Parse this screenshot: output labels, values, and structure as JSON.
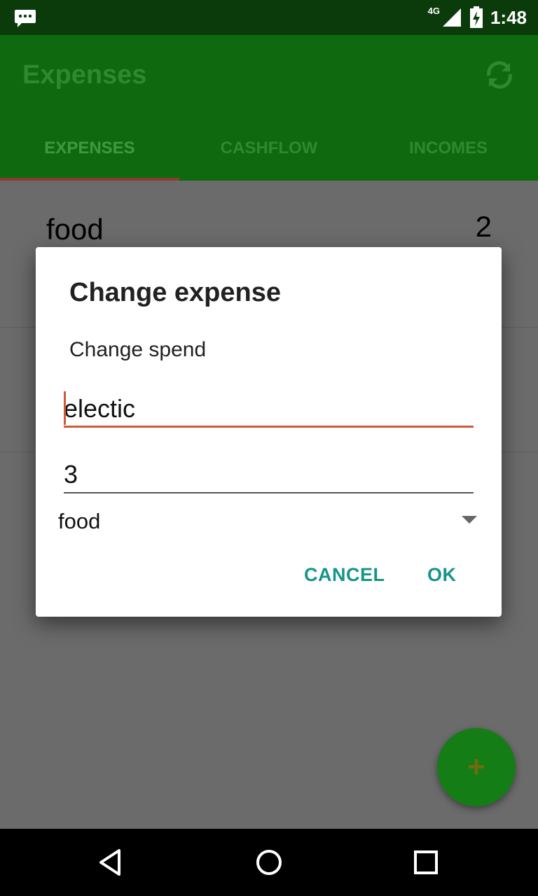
{
  "status_bar": {
    "network": "4G",
    "time": "1:48"
  },
  "app_bar": {
    "title": "Expenses",
    "sync_icon": "sync-icon"
  },
  "tabs": [
    {
      "label": "EXPENSES",
      "active": true
    },
    {
      "label": "CASHFLOW",
      "active": false
    },
    {
      "label": "INCOMES",
      "active": false
    }
  ],
  "list": {
    "items": [
      {
        "name": "food",
        "amount": "2"
      }
    ]
  },
  "dialog": {
    "title": "Change expense",
    "message": "Change spend",
    "name_value": "electic",
    "amount_value": "3",
    "category_selected": "food",
    "cancel_label": "CANCEL",
    "ok_label": "OK"
  },
  "fab": {
    "label": "+"
  },
  "colors": {
    "app_bar": "#0f6a0f",
    "status_bar": "#0b3b0b",
    "accent": "#cf5a3a",
    "button_text": "#16958a",
    "fab": "#157d15"
  }
}
